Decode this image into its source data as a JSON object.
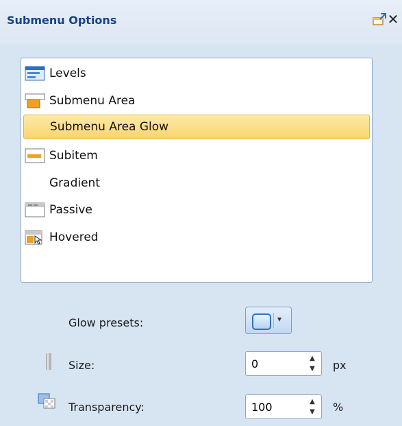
{
  "panel": {
    "title": "Submenu Options"
  },
  "list": {
    "items": [
      {
        "label": "Levels",
        "icon": "levels-icon"
      },
      {
        "label": "Submenu Area",
        "icon": "submenu-area-icon"
      },
      {
        "label": "Submenu Area Glow",
        "icon": "",
        "selected": true
      },
      {
        "label": "Subitem",
        "icon": "subitem-icon"
      },
      {
        "label": "Gradient",
        "icon": ""
      },
      {
        "label": "Passive",
        "icon": "passive-icon"
      },
      {
        "label": "Hovered",
        "icon": "hovered-icon"
      }
    ]
  },
  "glow": {
    "presets_label": "Glow presets:",
    "size_label": "Size:",
    "size_value": "0",
    "size_unit": "px",
    "transparency_label": "Transparency:",
    "transparency_value": "100",
    "transparency_unit": "%"
  },
  "colors": {
    "selected_bg": "#fbd56f",
    "selected_border": "#e6b33a",
    "title": "#15428b",
    "panel_bg": "#d7e4f2"
  }
}
